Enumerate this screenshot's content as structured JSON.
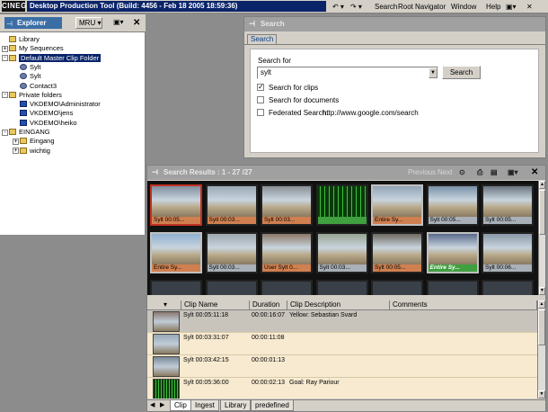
{
  "app": {
    "logo": "CINEGY",
    "title": "Desktop Production Tool (Build: 4456 - Feb 18 2005 18:59:36)",
    "menu": [
      "Search",
      "Root",
      "Navigator",
      "Window",
      "Help"
    ]
  },
  "explorer": {
    "title": "Explorer",
    "mru_label": "MRU",
    "tree": [
      {
        "label": "Library",
        "level": 0,
        "icon": "folder-icon",
        "expander": ""
      },
      {
        "label": "My Sequences",
        "level": 0,
        "icon": "folder-icon",
        "expander": "+"
      },
      {
        "label": "Default Master Clip Folder",
        "level": 0,
        "icon": "folder-icon",
        "expander": "-",
        "selected": true
      },
      {
        "label": "Sylt",
        "level": 1,
        "icon": "clip-icon",
        "expander": ""
      },
      {
        "label": "Sylt",
        "level": 1,
        "icon": "clip-icon",
        "expander": ""
      },
      {
        "label": "Contact3",
        "level": 1,
        "icon": "clip-icon",
        "expander": ""
      },
      {
        "label": "Private folders",
        "level": 0,
        "icon": "folder-icon",
        "expander": "-"
      },
      {
        "label": "VKDEMO\\Administrator",
        "level": 1,
        "icon": "user-icon",
        "expander": ""
      },
      {
        "label": "VKDEMO\\jens",
        "level": 1,
        "icon": "user-icon",
        "expander": ""
      },
      {
        "label": "VKDEMO\\heiko",
        "level": 1,
        "icon": "user-icon",
        "expander": ""
      },
      {
        "label": "EINGANG",
        "level": 0,
        "icon": "folder-icon",
        "expander": "-"
      },
      {
        "label": "Eingang",
        "level": 1,
        "icon": "folder-icon",
        "expander": "+"
      },
      {
        "label": "wichtig",
        "level": 1,
        "icon": "folder-icon",
        "expander": "+"
      }
    ]
  },
  "search": {
    "header": "Search",
    "tab": "Search",
    "label_search_for": "Search for",
    "input_value": "sylt",
    "button": "Search",
    "options": [
      {
        "label": "Search for clips",
        "checked": true
      },
      {
        "label": "Search for documents",
        "checked": false
      },
      {
        "label": "Federated Search:",
        "checked": false
      }
    ],
    "federated_url": "http://www.google.com/search"
  },
  "results": {
    "header": "Search Results : 1 - 27 /27",
    "nav": [
      "Previous",
      "Next"
    ],
    "thumbs": [
      {
        "caption": "Sylt 00:05...",
        "style": "org",
        "frame": "red",
        "color": "#7f8d9e"
      },
      {
        "caption": "Sylt 00:03...",
        "style": "org",
        "frame": "",
        "color": "#9aa8b4"
      },
      {
        "caption": "Sylt 00:03...",
        "style": "org",
        "frame": "",
        "color": "#8a8f94"
      },
      {
        "caption": "",
        "style": "grn",
        "frame": "",
        "color": "#1a5a1a"
      },
      {
        "caption": "Entire Sy...",
        "style": "org",
        "frame": "hl",
        "color": "#92a4b8"
      },
      {
        "caption": "Sylt 00:05...",
        "style": "",
        "frame": "",
        "color": "#7890a8"
      },
      {
        "caption": "Sylt 00:05...",
        "style": "",
        "frame": "",
        "color": "#6a7480"
      },
      {
        "caption": "Entire Sy...",
        "style": "org",
        "frame": "hl",
        "color": "#90b0d0"
      },
      {
        "caption": "Sylt 00:03...",
        "style": "",
        "frame": "",
        "color": "#a0a8b0"
      },
      {
        "caption": "User Sylt 0...",
        "style": "org",
        "frame": "",
        "color": "#8c7868"
      },
      {
        "caption": "Sylt 00:03...",
        "style": "",
        "frame": "",
        "color": "#98a490"
      },
      {
        "caption": "Sylt 00:05...",
        "style": "org",
        "frame": "",
        "color": "#6e6a60"
      },
      {
        "caption": "Entire Sy...",
        "style": "grn",
        "frame": "hl",
        "color": "#5a6a8a"
      },
      {
        "caption": "Sylt 00:06...",
        "style": "",
        "frame": "",
        "color": "#8a98a8"
      }
    ],
    "columns": [
      "Clip Name",
      "Duration",
      "Clip Description",
      "Comments"
    ],
    "rows": [
      {
        "name": "Sylt 00:05:11:18",
        "duration": "00:00:16:07",
        "description": "Yellow: Sebastian Svard",
        "comments": "",
        "thumb": "#8a7870"
      },
      {
        "name": "Sylt 00:03:31:07",
        "duration": "00:00:11:08",
        "description": "",
        "comments": "",
        "thumb": "#98a8b8"
      },
      {
        "name": "Sylt 00:03:42:15",
        "duration": "00:00:01:13",
        "description": "",
        "comments": "",
        "thumb": "#7a8a98"
      },
      {
        "name": "Sylt 00:05:36:00",
        "duration": "00:00:02:13",
        "description": "Goal: Ray Pariour",
        "comments": "",
        "thumb": "#1a6a1a"
      }
    ],
    "tabs": [
      "Clip",
      "Ingest",
      "Library",
      "predefined"
    ]
  }
}
